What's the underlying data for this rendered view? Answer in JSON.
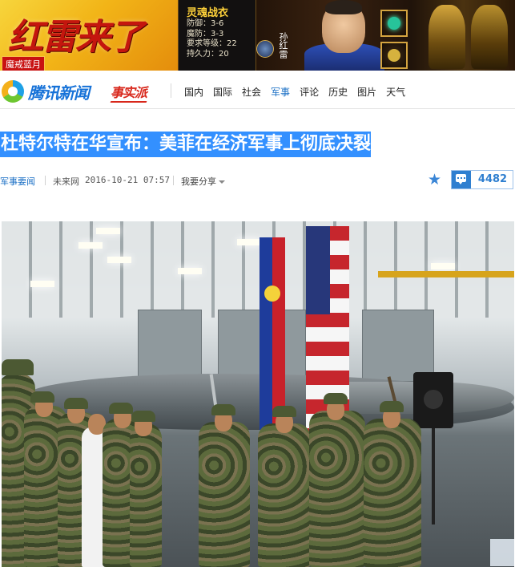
{
  "ad_banner": {
    "title": "红雷来了",
    "tag": "魔戒蓝月",
    "item_name": "灵魂战衣",
    "item_stats": [
      "防御：3-6",
      "魔防：3-3",
      "要求等级：22",
      "持久力：20"
    ],
    "character_name": "孙红雷"
  },
  "nav": {
    "logo_text": "腾讯新闻",
    "brand_tag": "事实派",
    "links": [
      {
        "label": "国内",
        "active": false
      },
      {
        "label": "国际",
        "active": false
      },
      {
        "label": "社会",
        "active": false
      },
      {
        "label": "军事",
        "active": true
      },
      {
        "label": "评论",
        "active": false
      },
      {
        "label": "历史",
        "active": false
      },
      {
        "label": "图片",
        "active": false
      },
      {
        "label": "天气",
        "active": false
      }
    ]
  },
  "article": {
    "title": "杜特尔特在华宣布：美菲在经济军事上彻底决裂",
    "category": "军事要闻",
    "source": "未来网",
    "timestamp": "2016-10-21 07:57",
    "share_label": "我要分享",
    "comment_count": "4482"
  },
  "colors": {
    "link_blue": "#1a6fc5",
    "selection_blue": "#3390ff",
    "accent_red": "#d8271b"
  }
}
